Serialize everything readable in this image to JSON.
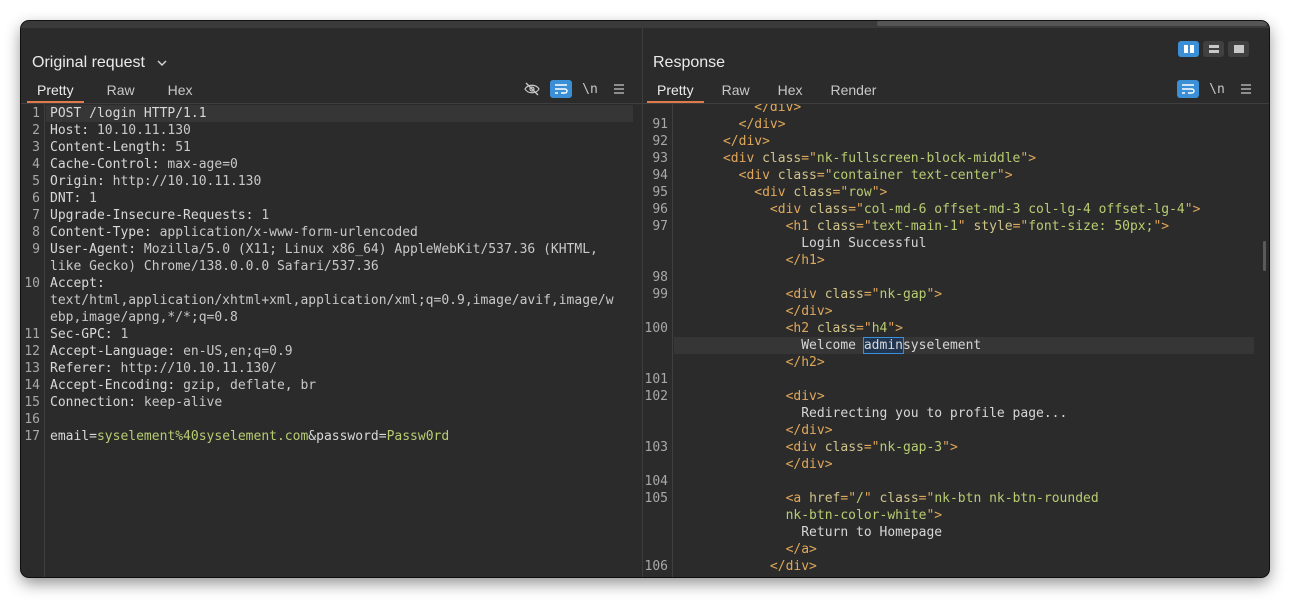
{
  "request": {
    "title": "Original request",
    "tabs": [
      "Pretty",
      "Raw",
      "Hex"
    ],
    "active_tab": "Pretty",
    "tool_icons": [
      "eye-off-icon",
      "wrap-icon",
      "newline-toggle",
      "menu-icon"
    ],
    "newline_label": "\\n",
    "lines": [
      {
        "n": "1",
        "parts": [
          {
            "t": "POST /login HTTP/1.1",
            "c": "k"
          }
        ]
      },
      {
        "n": "2",
        "parts": [
          {
            "t": "Host: ",
            "c": "k"
          },
          {
            "t": "10.10.11.130",
            "c": "v"
          }
        ]
      },
      {
        "n": "3",
        "parts": [
          {
            "t": "Content-Length: ",
            "c": "k"
          },
          {
            "t": "51",
            "c": "v"
          }
        ]
      },
      {
        "n": "4",
        "parts": [
          {
            "t": "Cache-Control: ",
            "c": "k"
          },
          {
            "t": "max-age=0",
            "c": "v"
          }
        ]
      },
      {
        "n": "5",
        "parts": [
          {
            "t": "Origin: ",
            "c": "k"
          },
          {
            "t": "http://10.10.11.130",
            "c": "v"
          }
        ]
      },
      {
        "n": "6",
        "parts": [
          {
            "t": "DNT: ",
            "c": "k"
          },
          {
            "t": "1",
            "c": "v"
          }
        ]
      },
      {
        "n": "7",
        "parts": [
          {
            "t": "Upgrade-Insecure-Requests: ",
            "c": "k"
          },
          {
            "t": "1",
            "c": "v"
          }
        ]
      },
      {
        "n": "8",
        "parts": [
          {
            "t": "Content-Type: ",
            "c": "k"
          },
          {
            "t": "application/x-www-form-urlencoded",
            "c": "v"
          }
        ]
      },
      {
        "n": "9",
        "parts": [
          {
            "t": "User-Agent: ",
            "c": "k"
          },
          {
            "t": "Mozilla/5.0 (X11; Linux x86_64) AppleWebKit/537.36 (KHTML,",
            "c": "v"
          }
        ]
      },
      {
        "n": "",
        "parts": [
          {
            "t": "like Gecko) Chrome/138.0.0.0 Safari/537.36",
            "c": "v"
          }
        ]
      },
      {
        "n": "10",
        "parts": [
          {
            "t": "Accept:",
            "c": "k"
          }
        ]
      },
      {
        "n": "",
        "parts": [
          {
            "t": "text/html,application/xhtml+xml,application/xml;q=0.9,image/avif,image/w",
            "c": "v"
          }
        ]
      },
      {
        "n": "",
        "parts": [
          {
            "t": "ebp,image/apng,*/*;q=0.8",
            "c": "v"
          }
        ]
      },
      {
        "n": "11",
        "parts": [
          {
            "t": "Sec-GPC: ",
            "c": "k"
          },
          {
            "t": "1",
            "c": "v"
          }
        ]
      },
      {
        "n": "12",
        "parts": [
          {
            "t": "Accept-Language: ",
            "c": "k"
          },
          {
            "t": "en-US,en;q=0.9",
            "c": "v"
          }
        ]
      },
      {
        "n": "13",
        "parts": [
          {
            "t": "Referer: ",
            "c": "k"
          },
          {
            "t": "http://10.10.11.130/",
            "c": "v"
          }
        ]
      },
      {
        "n": "14",
        "parts": [
          {
            "t": "Accept-Encoding: ",
            "c": "k"
          },
          {
            "t": "gzip, deflate, br",
            "c": "v"
          }
        ]
      },
      {
        "n": "15",
        "parts": [
          {
            "t": "Connection: ",
            "c": "k"
          },
          {
            "t": "keep-alive",
            "c": "v"
          }
        ]
      },
      {
        "n": "16",
        "parts": []
      },
      {
        "n": "17",
        "parts": [
          {
            "t": "email",
            "c": "k"
          },
          {
            "t": "=",
            "c": "k"
          },
          {
            "t": "syselement%40syselement.com",
            "c": "pv"
          },
          {
            "t": "&",
            "c": "k"
          },
          {
            "t": "password",
            "c": "k"
          },
          {
            "t": "=",
            "c": "k"
          },
          {
            "t": "Passw0rd",
            "c": "pv"
          }
        ]
      }
    ]
  },
  "response": {
    "title": "Response",
    "tabs": [
      "Pretty",
      "Raw",
      "Hex",
      "Render"
    ],
    "active_tab": "Pretty",
    "tool_icons": [
      "wrap-icon",
      "newline-toggle",
      "menu-icon"
    ],
    "newline_label": "\\n",
    "layout_icons": [
      "layout-columns-icon",
      "layout-rows-icon",
      "layout-single-icon"
    ],
    "lines": [
      {
        "n": "",
        "parts": [
          {
            "t": "          </",
            "c": "tg"
          },
          {
            "t": "div",
            "c": "tg"
          },
          {
            "t": ">",
            "c": "tg"
          }
        ]
      },
      {
        "n": "91",
        "parts": [
          {
            "t": "        </div>",
            "c": "tg"
          }
        ]
      },
      {
        "n": "92",
        "parts": [
          {
            "t": "      </div>",
            "c": "tg"
          }
        ]
      },
      {
        "n": "93",
        "parts": [
          {
            "t": "      <div ",
            "c": "tg"
          },
          {
            "t": "class",
            "c": "an"
          },
          {
            "t": "=\"",
            "c": "tg"
          },
          {
            "t": "nk-fullscreen-block-middle",
            "c": "av"
          },
          {
            "t": "\">",
            "c": "tg"
          }
        ]
      },
      {
        "n": "94",
        "parts": [
          {
            "t": "        <div ",
            "c": "tg"
          },
          {
            "t": "class",
            "c": "an"
          },
          {
            "t": "=\"",
            "c": "tg"
          },
          {
            "t": "container text-center",
            "c": "av"
          },
          {
            "t": "\">",
            "c": "tg"
          }
        ]
      },
      {
        "n": "95",
        "parts": [
          {
            "t": "          <div ",
            "c": "tg"
          },
          {
            "t": "class",
            "c": "an"
          },
          {
            "t": "=\"",
            "c": "tg"
          },
          {
            "t": "row",
            "c": "av"
          },
          {
            "t": "\">",
            "c": "tg"
          }
        ]
      },
      {
        "n": "96",
        "parts": [
          {
            "t": "            <div ",
            "c": "tg"
          },
          {
            "t": "class",
            "c": "an"
          },
          {
            "t": "=\"",
            "c": "tg"
          },
          {
            "t": "col-md-6 offset-md-3 col-lg-4 offset-lg-4",
            "c": "av"
          },
          {
            "t": "\">",
            "c": "tg"
          }
        ]
      },
      {
        "n": "97",
        "parts": [
          {
            "t": "              <h1 ",
            "c": "tg"
          },
          {
            "t": "class",
            "c": "an"
          },
          {
            "t": "=\"",
            "c": "tg"
          },
          {
            "t": "text-main-1",
            "c": "av"
          },
          {
            "t": "\" ",
            "c": "tg"
          },
          {
            "t": "style",
            "c": "an"
          },
          {
            "t": "=\"",
            "c": "tg"
          },
          {
            "t": "font-size: 50px;",
            "c": "av"
          },
          {
            "t": "\">",
            "c": "tg"
          }
        ]
      },
      {
        "n": "",
        "parts": [
          {
            "t": "                Login Successful",
            "c": "txt"
          }
        ]
      },
      {
        "n": "",
        "parts": [
          {
            "t": "              </h1>",
            "c": "tg"
          }
        ]
      },
      {
        "n": "98",
        "parts": []
      },
      {
        "n": "99",
        "parts": [
          {
            "t": "              <div ",
            "c": "tg"
          },
          {
            "t": "class",
            "c": "an"
          },
          {
            "t": "=\"",
            "c": "tg"
          },
          {
            "t": "nk-gap",
            "c": "av"
          },
          {
            "t": "\">",
            "c": "tg"
          }
        ]
      },
      {
        "n": "",
        "parts": [
          {
            "t": "              </div>",
            "c": "tg"
          }
        ]
      },
      {
        "n": "100",
        "parts": [
          {
            "t": "              <h2 ",
            "c": "tg"
          },
          {
            "t": "class",
            "c": "an"
          },
          {
            "t": "=\"",
            "c": "tg"
          },
          {
            "t": "h4",
            "c": "av"
          },
          {
            "t": "\">",
            "c": "tg"
          }
        ]
      },
      {
        "n": "",
        "hl": true,
        "parts": [
          {
            "t": "                Welcome ",
            "c": "txt"
          },
          {
            "t": "admin",
            "c": "sel"
          },
          {
            "t": "syselement",
            "c": "txt"
          }
        ]
      },
      {
        "n": "",
        "parts": [
          {
            "t": "              </h2>",
            "c": "tg"
          }
        ]
      },
      {
        "n": "101",
        "parts": []
      },
      {
        "n": "102",
        "parts": [
          {
            "t": "              <div>",
            "c": "tg"
          }
        ]
      },
      {
        "n": "",
        "parts": [
          {
            "t": "                Redirecting you to profile page...",
            "c": "txt"
          }
        ]
      },
      {
        "n": "",
        "parts": [
          {
            "t": "              </div>",
            "c": "tg"
          }
        ]
      },
      {
        "n": "103",
        "parts": [
          {
            "t": "              <div ",
            "c": "tg"
          },
          {
            "t": "class",
            "c": "an"
          },
          {
            "t": "=\"",
            "c": "tg"
          },
          {
            "t": "nk-gap-3",
            "c": "av"
          },
          {
            "t": "\">",
            "c": "tg"
          }
        ]
      },
      {
        "n": "",
        "parts": [
          {
            "t": "              </div>",
            "c": "tg"
          }
        ]
      },
      {
        "n": "104",
        "parts": []
      },
      {
        "n": "105",
        "parts": [
          {
            "t": "              <a ",
            "c": "tg"
          },
          {
            "t": "href",
            "c": "an"
          },
          {
            "t": "=\"",
            "c": "tg"
          },
          {
            "t": "/",
            "c": "av"
          },
          {
            "t": "\" ",
            "c": "tg"
          },
          {
            "t": "class",
            "c": "an"
          },
          {
            "t": "=\"",
            "c": "tg"
          },
          {
            "t": "nk-btn nk-btn-rounded",
            "c": "av"
          }
        ]
      },
      {
        "n": "",
        "parts": [
          {
            "t": "              nk-btn-color-white",
            "c": "av"
          },
          {
            "t": "\">",
            "c": "tg"
          }
        ]
      },
      {
        "n": "",
        "parts": [
          {
            "t": "                Return to Homepage",
            "c": "txt"
          }
        ]
      },
      {
        "n": "",
        "parts": [
          {
            "t": "              </a>",
            "c": "tg"
          }
        ]
      },
      {
        "n": "106",
        "parts": [
          {
            "t": "            </div>",
            "c": "tg"
          }
        ]
      }
    ]
  }
}
